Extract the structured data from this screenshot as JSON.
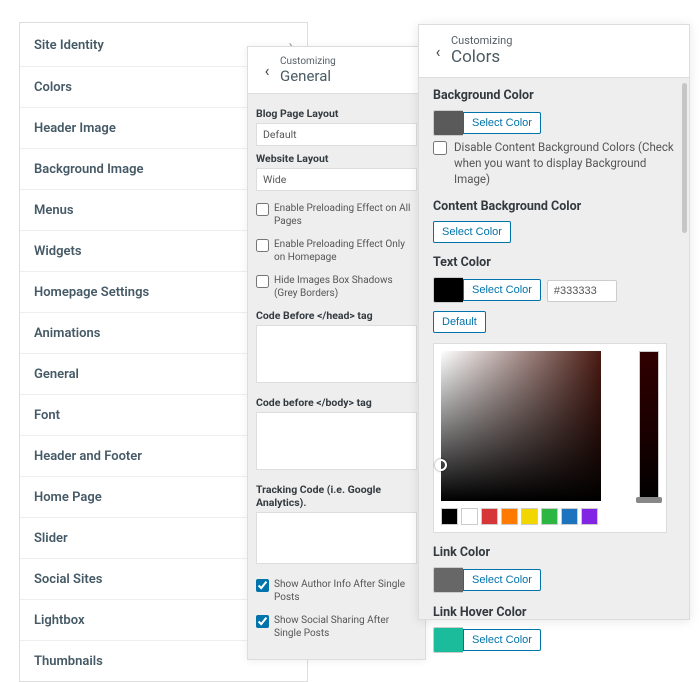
{
  "panel1": {
    "items": [
      {
        "label": "Site Identity",
        "has_chevron": true
      },
      {
        "label": "Colors"
      },
      {
        "label": "Header Image"
      },
      {
        "label": "Background Image"
      },
      {
        "label": "Menus"
      },
      {
        "label": "Widgets"
      },
      {
        "label": "Homepage Settings"
      },
      {
        "label": "Animations"
      },
      {
        "label": "General"
      },
      {
        "label": "Font"
      },
      {
        "label": "Header and Footer"
      },
      {
        "label": "Home Page"
      },
      {
        "label": "Slider"
      },
      {
        "label": "Social Sites"
      },
      {
        "label": "Lightbox"
      },
      {
        "label": "Thumbnails"
      }
    ]
  },
  "panel2": {
    "breadcrumb": "Customizing",
    "title": "General",
    "blog_layout_label": "Blog Page Layout",
    "blog_layout_value": "Default",
    "website_layout_label": "Website Layout",
    "website_layout_value": "Wide",
    "opt_preload_all": "Enable Preloading Effect on All Pages",
    "opt_preload_home": "Enable Preloading Effect Only on Homepage",
    "opt_hide_shadows": "Hide Images Box Shadows (Grey Borders)",
    "code_head_label": "Code Before </head> tag",
    "code_body_label": "Code before </body> tag",
    "tracking_label": "Tracking Code (i.e. Google Analytics).",
    "opt_author_info": "Show Author Info After Single Posts",
    "opt_social_sharing": "Show Social Sharing After Single Posts",
    "opt_preload_all_checked": false,
    "opt_preload_home_checked": false,
    "opt_hide_shadows_checked": false,
    "opt_author_info_checked": true,
    "opt_social_sharing_checked": true
  },
  "panel3": {
    "breadcrumb": "Customizing",
    "title": "Colors",
    "bg_label": "Background Color",
    "bg_swatch": "#5a5a5a",
    "disable_content_bg": "Disable Content Background Colors (Check when you want to display Background Image)",
    "disable_content_bg_checked": false,
    "content_bg_label": "Content Background Color",
    "text_color_label": "Text Color",
    "text_color_swatch": "#000000",
    "text_color_hex": "#333333",
    "default_btn": "Default",
    "select_color_btn": "Select Color",
    "palette": [
      "#000000",
      "#ffffff",
      "#d63638",
      "#ff7a00",
      "#f2d600",
      "#2db742",
      "#1e73be",
      "#8224e3"
    ],
    "link_color_label": "Link Color",
    "link_color_swatch": "#676767",
    "link_hover_label": "Link Hover Color",
    "link_hover_swatch": "#1abc9c"
  }
}
